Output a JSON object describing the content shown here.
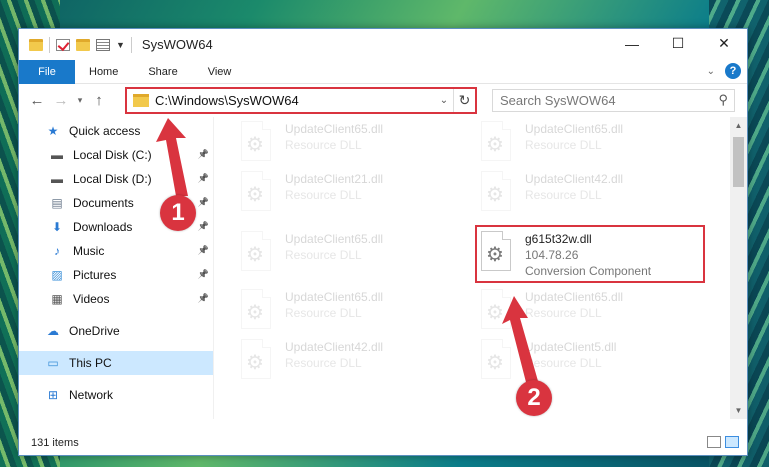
{
  "window": {
    "title": "SysWOW64",
    "controls": {
      "minimize": "—",
      "maximize": "☐",
      "close": "✕"
    }
  },
  "ribbon": {
    "tabs": [
      "File",
      "Home",
      "Share",
      "View"
    ],
    "help": "?"
  },
  "nav": {
    "address": "C:\\Windows\\SysWOW64",
    "search_placeholder": "Search SysWOW64"
  },
  "sidebar": {
    "items": [
      {
        "label": "Quick access",
        "icon": "star-icon",
        "pinned": false
      },
      {
        "label": "Local Disk (C:)",
        "icon": "drive-icon",
        "pinned": true
      },
      {
        "label": "Local Disk (D:)",
        "icon": "drive-icon",
        "pinned": true
      },
      {
        "label": "Documents",
        "icon": "documents-icon",
        "pinned": true
      },
      {
        "label": "Downloads",
        "icon": "downloads-icon",
        "pinned": true
      },
      {
        "label": "Music",
        "icon": "music-icon",
        "pinned": true
      },
      {
        "label": "Pictures",
        "icon": "pictures-icon",
        "pinned": true
      },
      {
        "label": "Videos",
        "icon": "videos-icon",
        "pinned": true
      },
      {
        "label": "OneDrive",
        "icon": "cloud-icon",
        "pinned": false
      },
      {
        "label": "This PC",
        "icon": "computer-icon",
        "pinned": false,
        "selected": true
      },
      {
        "label": "Network",
        "icon": "network-icon",
        "pinned": false
      }
    ]
  },
  "files": [
    {
      "name": "UpdateClient65.dll",
      "line2": "Resource DLL",
      "faded": true
    },
    {
      "name": "UpdateClient65.dll",
      "line2": "Resource DLL",
      "faded": true
    },
    {
      "name": "UpdateClient21.dll",
      "line2": "Resource DLL",
      "faded": true
    },
    {
      "name": "UpdateClient42.dll",
      "line2": "Resource DLL",
      "faded": true
    },
    {
      "name": "UpdateClient65.dll",
      "line2": "Resource DLL",
      "faded": true
    },
    {
      "name": "g615t32w.dll",
      "line2": "104.78.26",
      "line3": "Conversion Component",
      "faded": false
    },
    {
      "name": "UpdateClient65.dll",
      "line2": "Resource DLL",
      "faded": true
    },
    {
      "name": "UpdateClient65.dll",
      "line2": "Resource DLL",
      "faded": true
    },
    {
      "name": "UpdateClient42.dll",
      "line2": "Resource DLL",
      "faded": true
    },
    {
      "name": "UpdateClient5.dll",
      "line2": "Resource DLL",
      "faded": true
    }
  ],
  "status": {
    "count": "131 items"
  },
  "annotations": {
    "step1": "1",
    "step2": "2",
    "color": "#d9343f"
  }
}
